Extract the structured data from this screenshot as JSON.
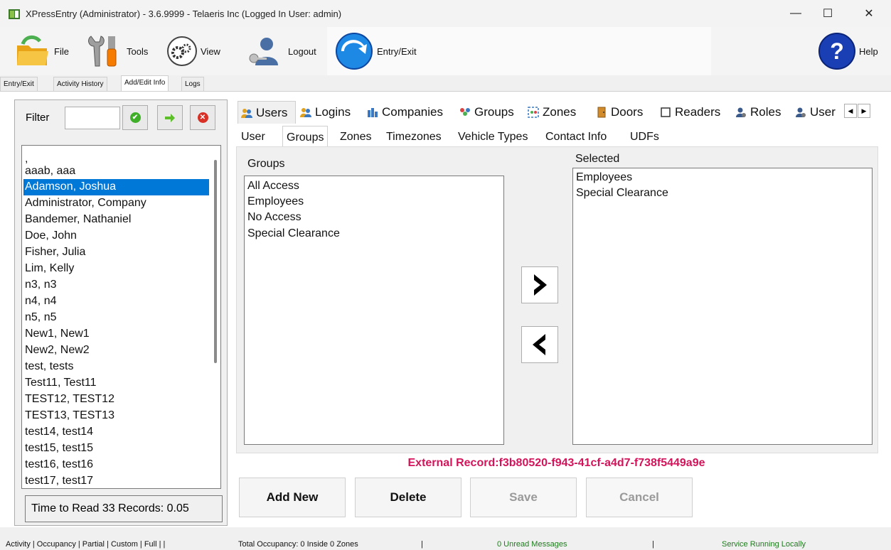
{
  "window": {
    "title": "XPressEntry (Administrator)  - 3.6.9999 - Telaeris Inc (Logged In User: admin)",
    "minimize": "—",
    "maximize": "☐",
    "close": "✕"
  },
  "ribbon": {
    "file": "File",
    "tools": "Tools",
    "view": "View",
    "logout": "Logout",
    "entry_exit": "Entry/Exit",
    "help": "Help"
  },
  "main_tabs": [
    "Entry/Exit",
    "Activity History",
    "Add/Edit Info",
    "Logs"
  ],
  "filter": {
    "label": "Filter",
    "value": ""
  },
  "user_list": [
    ",",
    "aaab, aaa",
    "Adamson, Joshua",
    "Administrator, Company",
    "Bandemer, Nathaniel",
    "Doe, John",
    "Fisher, Julia",
    "Lim, Kelly",
    "n3, n3",
    "n4, n4",
    "n5, n5",
    "New1, New1",
    "New2, New2",
    "test, tests",
    "Test11, Test11",
    "TEST12, TEST12",
    "TEST13, TEST13",
    "test14, test14",
    "test15, test15",
    "test16, test16",
    "test17, test17"
  ],
  "selected_user": "Adamson, Joshua",
  "time_to_read": "Time to Read 33 Records: 0.05",
  "entity_tabs": [
    "Users",
    "Logins",
    "Companies",
    "Groups",
    "Zones",
    "Doors",
    "Readers",
    "Roles",
    "User"
  ],
  "sub_tabs": [
    "User",
    "Groups",
    "Zones",
    "Timezones",
    "Vehicle Types",
    "Contact Info",
    "UDFs"
  ],
  "groups": {
    "available_label": "Groups",
    "available": [
      "All Access",
      "Employees",
      "No Access",
      "Special Clearance"
    ],
    "selected_label": "Selected",
    "selected": [
      "Employees",
      "Special Clearance"
    ],
    "add_arrow": "❯",
    "remove_arrow": "❮"
  },
  "external_record": "External Record:f3b80520-f943-41cf-a4d7-f738f5449a9e",
  "actions": {
    "add_new": "Add New",
    "delete": "Delete",
    "save": "Save",
    "cancel": "Cancel"
  },
  "status_bar": {
    "views": "Activity | Occupancy | Partial | Custom | Full | |",
    "occupancy": "Total Occupancy: 0 Inside 0 Zones",
    "sep1": "|",
    "messages": "0 Unread Messages",
    "sep2": "|",
    "service": "Service Running Locally"
  },
  "colors": {
    "selection": "#0078d7",
    "external_record": "#d4145a",
    "status_green": "#1e7b1e"
  }
}
